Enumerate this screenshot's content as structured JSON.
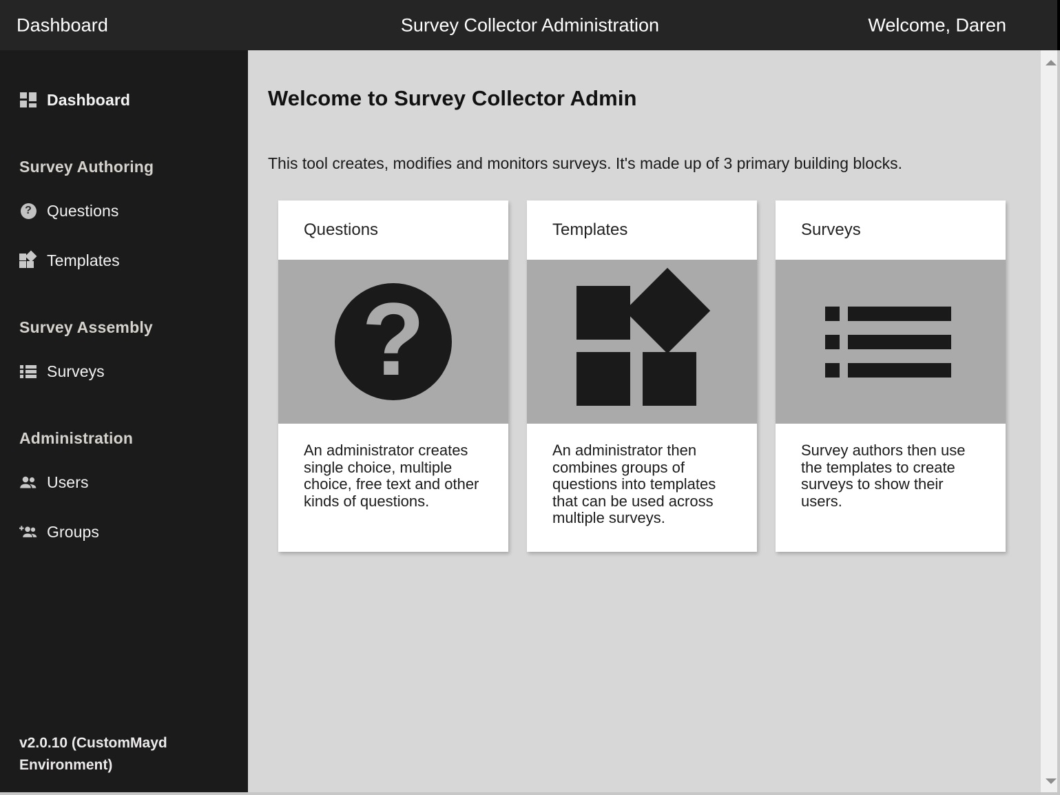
{
  "topbar": {
    "left_label": "Dashboard",
    "title": "Survey Collector Administration",
    "welcome": "Welcome, Daren",
    "background_color": "#252525",
    "text_color": "#ffffff"
  },
  "sidebar": {
    "background_color": "#1b1b1b",
    "active_item": "Dashboard",
    "top_item": {
      "label": "Dashboard",
      "icon": "dashboard-grid-icon"
    },
    "sections": [
      {
        "heading": "Survey Authoring",
        "items": [
          {
            "label": "Questions",
            "icon": "question-circle-icon"
          },
          {
            "label": "Templates",
            "icon": "templates-shapes-icon"
          }
        ]
      },
      {
        "heading": "Survey Assembly",
        "items": [
          {
            "label": "Surveys",
            "icon": "list-icon"
          }
        ]
      },
      {
        "heading": "Administration",
        "items": [
          {
            "label": "Users",
            "icon": "users-icon"
          },
          {
            "label": "Groups",
            "icon": "add-group-icon"
          }
        ]
      }
    ],
    "version": "v2.0.10 (CustomMayd Environment)"
  },
  "main": {
    "background_color": "#d7d7d7",
    "page_title": "Welcome to Survey Collector Admin",
    "intro": "This tool creates, modifies and monitors surveys. It's made up of 3 primary building blocks.",
    "cards": [
      {
        "title": "Questions",
        "icon": "question-mark-circle-icon",
        "text": "An administrator creates single choice, multiple choice, free text and other kinds of questions."
      },
      {
        "title": "Templates",
        "icon": "three-squares-diamond-icon",
        "text": "An administrator then combines groups of questions into templates that can be used across multiple surveys."
      },
      {
        "title": "Surveys",
        "icon": "bulleted-list-icon",
        "text": "Survey authors then use the templates to create surveys to show their users."
      }
    ],
    "card_media_color": "#aaaaaa",
    "card_background_color": "#ffffff"
  },
  "scrollbar": {
    "up_icon": "scroll-up-arrow-icon",
    "down_icon": "scroll-down-arrow-icon",
    "track_color": "#f0f0f0"
  }
}
